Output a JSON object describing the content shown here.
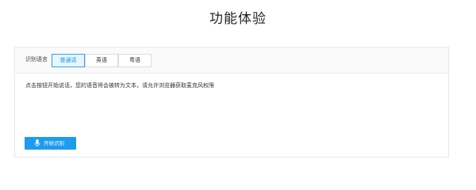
{
  "page": {
    "title": "功能体验"
  },
  "language_selector": {
    "label": "识别语言",
    "options": [
      {
        "label": "普通话",
        "selected": true
      },
      {
        "label": "英语",
        "selected": false
      },
      {
        "label": "粤语",
        "selected": false
      }
    ]
  },
  "result_area": {
    "hint": "点击按钮开始说话，您的语音将会被转为文本，请允许浏览器获取麦克风权限"
  },
  "controls": {
    "start_label": "开始识别",
    "start_icon": "microphone-icon"
  },
  "colors": {
    "accent": "#1e9bf0",
    "selected_tab_background": "#e8f5fe"
  }
}
